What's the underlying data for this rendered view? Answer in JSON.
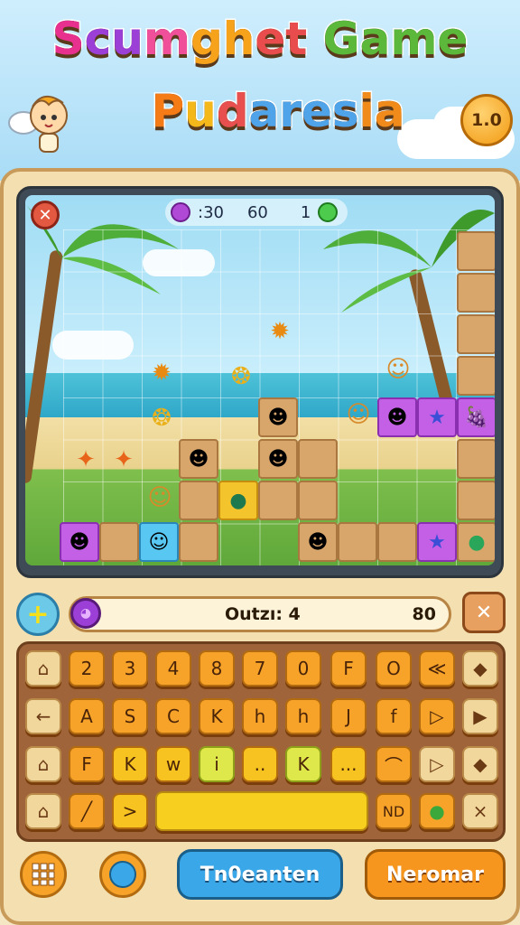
{
  "title": {
    "line1_parts": [
      "S",
      "cu",
      "m",
      "gh",
      "et",
      "Game"
    ],
    "line2_parts": [
      "P",
      "u",
      "d",
      "ares",
      "ia"
    ]
  },
  "version_badge": "1.0",
  "hud": {
    "gems": ":30",
    "score": "60",
    "lives": "1"
  },
  "board_icons": {
    "close": "close-icon"
  },
  "status_bar": {
    "label": "Outzı: 4",
    "value": "80"
  },
  "side_buttons": {
    "add": "+",
    "close": "✕"
  },
  "keyboard": {
    "row1": [
      "⌂",
      "2",
      "3",
      "4",
      "8",
      "7",
      "0",
      "F",
      "O",
      "≪",
      "◆"
    ],
    "row2": [
      "←",
      "A",
      "S",
      "C",
      "K",
      "h",
      "h",
      "J",
      "f",
      "▷",
      "▶"
    ],
    "row3": [
      "⌂",
      "F",
      "K",
      "w",
      "i",
      "..",
      "K",
      "...",
      "⌒",
      "▷",
      "◆"
    ],
    "row4": [
      "⌂",
      "╱",
      ">",
      "ND",
      "●",
      "×"
    ]
  },
  "bottom": {
    "grid_icon": "grid-icon",
    "circle_icon": "circle-icon",
    "primary_label": "Tn0eanten",
    "secondary_label": "Neromar"
  },
  "colors": {
    "primary_button": "#3aa8e8",
    "secondary_button": "#f6961e",
    "accent": "#f7a32a"
  }
}
